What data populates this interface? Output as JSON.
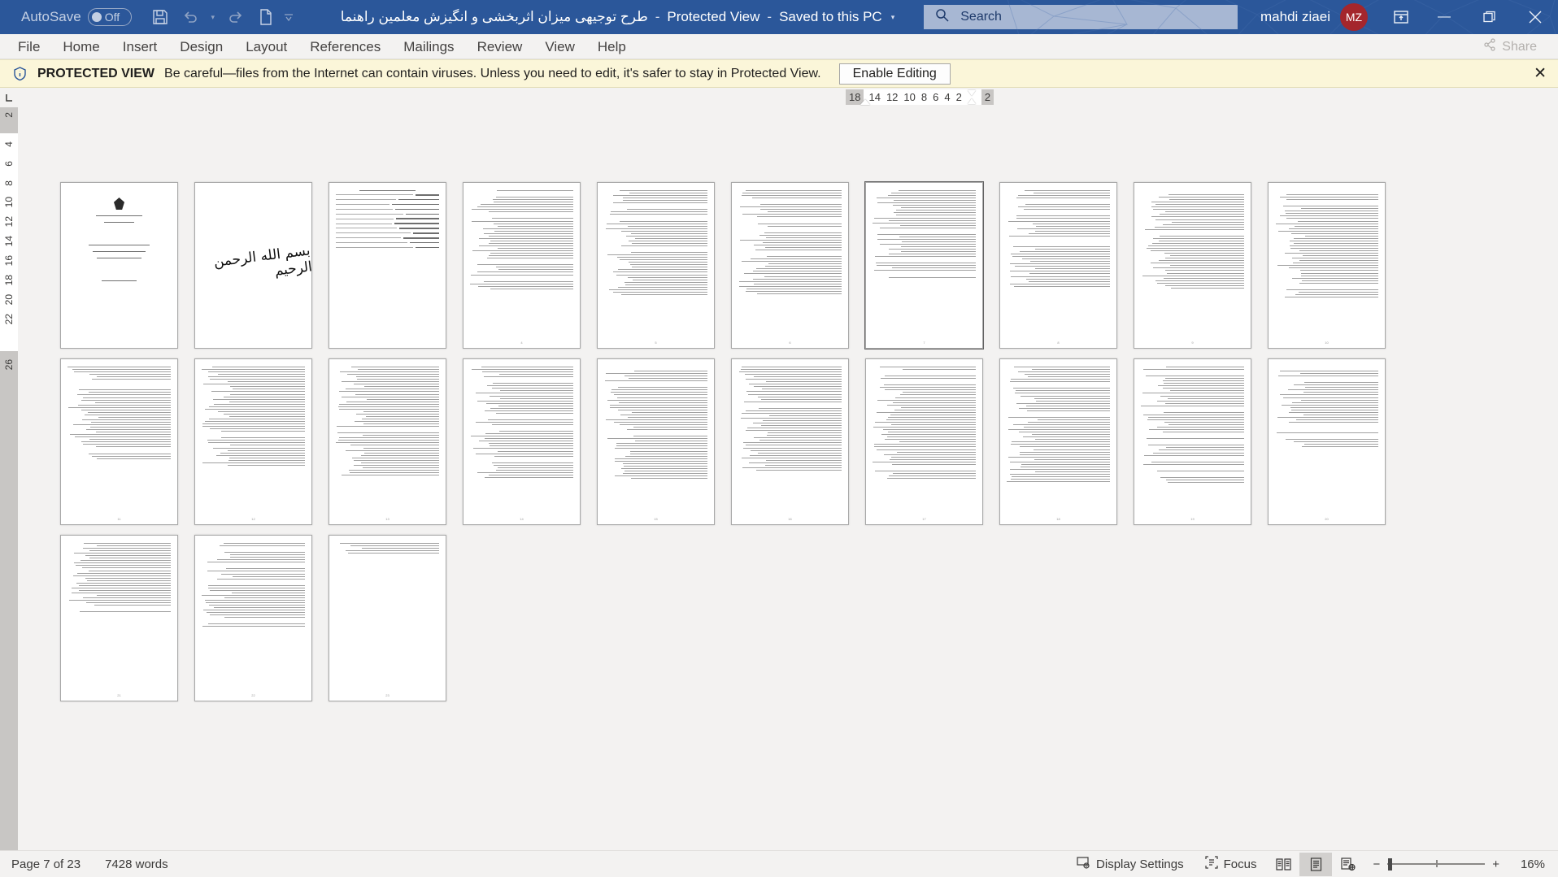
{
  "titlebar": {
    "autosave_label": "AutoSave",
    "autosave_state": "Off",
    "icons": [
      "save-icon",
      "undo-icon",
      "redo-icon",
      "new-file-icon",
      "customize-qat-icon"
    ],
    "document_title": "طرح توجیهی میزان اثربخشی و انگیزش معلمین راهنما",
    "separator1": "-",
    "protected_view_label": "Protected View",
    "separator2": "-",
    "save_state": "Saved to this PC",
    "title_caret": "▾",
    "search_placeholder": "Search",
    "search_icon": "search-icon",
    "user_name": "mahdi ziaei",
    "user_initials": "MZ",
    "ribbon_display_icon": "ribbon-display-options-icon",
    "minimize": "—",
    "restore": "❐",
    "close": "✕"
  },
  "ribbon": {
    "tabs": [
      {
        "label": "File"
      },
      {
        "label": "Home"
      },
      {
        "label": "Insert"
      },
      {
        "label": "Design"
      },
      {
        "label": "Layout"
      },
      {
        "label": "References"
      },
      {
        "label": "Mailings"
      },
      {
        "label": "Review"
      },
      {
        "label": "View"
      },
      {
        "label": "Help"
      }
    ],
    "share_label": "Share",
    "share_icon": "share-icon"
  },
  "protected_view": {
    "icon": "info-shield-icon",
    "strong": "PROTECTED VIEW",
    "message": "Be careful—files from the Internet can contain viruses. Unless you need to edit, it's safer to stay in Protected View.",
    "enable_button": "Enable Editing",
    "close_icon": "✕"
  },
  "rulers": {
    "tabstop_icon": "L",
    "horizontal_left_ticks": [
      "18"
    ],
    "horizontal_ticks": [
      "14",
      "12",
      "10",
      "8",
      "6",
      "4",
      "2"
    ],
    "horizontal_right_ticks": [
      "2"
    ],
    "vertical_top_tick": "2",
    "vertical_ticks": [
      "4",
      "6",
      "8",
      "10",
      "12",
      "14",
      "16",
      "18",
      "20",
      "22"
    ],
    "vertical_bottom_tick": "26"
  },
  "document": {
    "zoom_view": "multiple-pages-thumbnail-view",
    "pages": [
      {
        "n": 1,
        "kind": "title",
        "lines": 0,
        "selected": false
      },
      {
        "n": 2,
        "kind": "bismillah",
        "lines": 0,
        "selected": false
      },
      {
        "n": 3,
        "kind": "toc",
        "lines": 12,
        "selected": false
      },
      {
        "n": 4,
        "kind": "text",
        "lines": 38,
        "selected": false
      },
      {
        "n": 5,
        "kind": "text",
        "lines": 41,
        "selected": false
      },
      {
        "n": 6,
        "kind": "text",
        "lines": 40,
        "selected": false
      },
      {
        "n": 7,
        "kind": "text",
        "lines": 34,
        "selected": true
      },
      {
        "n": 8,
        "kind": "text",
        "lines": 37,
        "selected": false
      },
      {
        "n": 9,
        "kind": "text",
        "lines": 39,
        "selected": false
      },
      {
        "n": 10,
        "kind": "text",
        "lines": 42,
        "selected": false
      },
      {
        "n": 11,
        "kind": "text",
        "lines": 36,
        "selected": false
      },
      {
        "n": 12,
        "kind": "text",
        "lines": 40,
        "selected": false
      },
      {
        "n": 13,
        "kind": "text",
        "lines": 44,
        "selected": false
      },
      {
        "n": 14,
        "kind": "text",
        "lines": 43,
        "selected": false
      },
      {
        "n": 15,
        "kind": "text",
        "lines": 45,
        "selected": false
      },
      {
        "n": 16,
        "kind": "text",
        "lines": 42,
        "selected": false
      },
      {
        "n": 17,
        "kind": "text",
        "lines": 44,
        "selected": false
      },
      {
        "n": 18,
        "kind": "text",
        "lines": 46,
        "selected": false
      },
      {
        "n": 19,
        "kind": "text",
        "lines": 43,
        "selected": false
      },
      {
        "n": 20,
        "kind": "text",
        "lines": 30,
        "selected": false
      },
      {
        "n": 21,
        "kind": "text",
        "lines": 28,
        "selected": false
      },
      {
        "n": 22,
        "kind": "text",
        "lines": 32,
        "selected": false
      },
      {
        "n": 23,
        "kind": "short",
        "lines": 5,
        "selected": false
      }
    ]
  },
  "statusbar": {
    "page_info": "Page 7 of 23",
    "word_count": "7428 words",
    "display_settings": "Display Settings",
    "display_settings_icon": "display-settings-icon",
    "focus": "Focus",
    "focus_icon": "focus-icon",
    "view_read_icon": "read-mode-icon",
    "view_print_icon": "print-layout-icon",
    "view_web_icon": "web-layout-icon",
    "zoom_out": "−",
    "zoom_in": "+",
    "zoom_level": "16%"
  },
  "colors": {
    "brand": "#2b579a",
    "banner": "#fbf6d9",
    "avatar": "#a4262c",
    "chrome": "#f3f2f1"
  }
}
